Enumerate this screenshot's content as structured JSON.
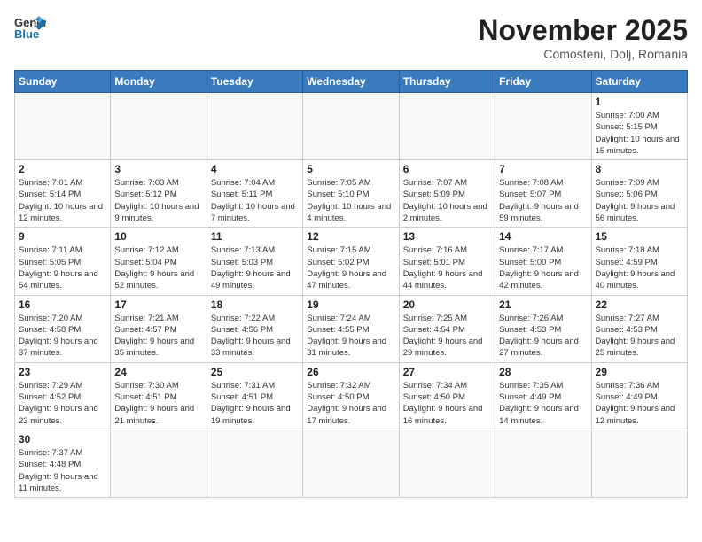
{
  "logo": {
    "text_general": "General",
    "text_blue": "Blue"
  },
  "title": "November 2025",
  "location": "Comosteni, Dolj, Romania",
  "days_of_week": [
    "Sunday",
    "Monday",
    "Tuesday",
    "Wednesday",
    "Thursday",
    "Friday",
    "Saturday"
  ],
  "weeks": [
    [
      {
        "day": "",
        "info": ""
      },
      {
        "day": "",
        "info": ""
      },
      {
        "day": "",
        "info": ""
      },
      {
        "day": "",
        "info": ""
      },
      {
        "day": "",
        "info": ""
      },
      {
        "day": "",
        "info": ""
      },
      {
        "day": "1",
        "info": "Sunrise: 7:00 AM\nSunset: 5:15 PM\nDaylight: 10 hours\nand 15 minutes."
      }
    ],
    [
      {
        "day": "2",
        "info": "Sunrise: 7:01 AM\nSunset: 5:14 PM\nDaylight: 10 hours\nand 12 minutes."
      },
      {
        "day": "3",
        "info": "Sunrise: 7:03 AM\nSunset: 5:12 PM\nDaylight: 10 hours\nand 9 minutes."
      },
      {
        "day": "4",
        "info": "Sunrise: 7:04 AM\nSunset: 5:11 PM\nDaylight: 10 hours\nand 7 minutes."
      },
      {
        "day": "5",
        "info": "Sunrise: 7:05 AM\nSunset: 5:10 PM\nDaylight: 10 hours\nand 4 minutes."
      },
      {
        "day": "6",
        "info": "Sunrise: 7:07 AM\nSunset: 5:09 PM\nDaylight: 10 hours\nand 2 minutes."
      },
      {
        "day": "7",
        "info": "Sunrise: 7:08 AM\nSunset: 5:07 PM\nDaylight: 9 hours\nand 59 minutes."
      },
      {
        "day": "8",
        "info": "Sunrise: 7:09 AM\nSunset: 5:06 PM\nDaylight: 9 hours\nand 56 minutes."
      }
    ],
    [
      {
        "day": "9",
        "info": "Sunrise: 7:11 AM\nSunset: 5:05 PM\nDaylight: 9 hours\nand 54 minutes."
      },
      {
        "day": "10",
        "info": "Sunrise: 7:12 AM\nSunset: 5:04 PM\nDaylight: 9 hours\nand 52 minutes."
      },
      {
        "day": "11",
        "info": "Sunrise: 7:13 AM\nSunset: 5:03 PM\nDaylight: 9 hours\nand 49 minutes."
      },
      {
        "day": "12",
        "info": "Sunrise: 7:15 AM\nSunset: 5:02 PM\nDaylight: 9 hours\nand 47 minutes."
      },
      {
        "day": "13",
        "info": "Sunrise: 7:16 AM\nSunset: 5:01 PM\nDaylight: 9 hours\nand 44 minutes."
      },
      {
        "day": "14",
        "info": "Sunrise: 7:17 AM\nSunset: 5:00 PM\nDaylight: 9 hours\nand 42 minutes."
      },
      {
        "day": "15",
        "info": "Sunrise: 7:18 AM\nSunset: 4:59 PM\nDaylight: 9 hours\nand 40 minutes."
      }
    ],
    [
      {
        "day": "16",
        "info": "Sunrise: 7:20 AM\nSunset: 4:58 PM\nDaylight: 9 hours\nand 37 minutes."
      },
      {
        "day": "17",
        "info": "Sunrise: 7:21 AM\nSunset: 4:57 PM\nDaylight: 9 hours\nand 35 minutes."
      },
      {
        "day": "18",
        "info": "Sunrise: 7:22 AM\nSunset: 4:56 PM\nDaylight: 9 hours\nand 33 minutes."
      },
      {
        "day": "19",
        "info": "Sunrise: 7:24 AM\nSunset: 4:55 PM\nDaylight: 9 hours\nand 31 minutes."
      },
      {
        "day": "20",
        "info": "Sunrise: 7:25 AM\nSunset: 4:54 PM\nDaylight: 9 hours\nand 29 minutes."
      },
      {
        "day": "21",
        "info": "Sunrise: 7:26 AM\nSunset: 4:53 PM\nDaylight: 9 hours\nand 27 minutes."
      },
      {
        "day": "22",
        "info": "Sunrise: 7:27 AM\nSunset: 4:53 PM\nDaylight: 9 hours\nand 25 minutes."
      }
    ],
    [
      {
        "day": "23",
        "info": "Sunrise: 7:29 AM\nSunset: 4:52 PM\nDaylight: 9 hours\nand 23 minutes."
      },
      {
        "day": "24",
        "info": "Sunrise: 7:30 AM\nSunset: 4:51 PM\nDaylight: 9 hours\nand 21 minutes."
      },
      {
        "day": "25",
        "info": "Sunrise: 7:31 AM\nSunset: 4:51 PM\nDaylight: 9 hours\nand 19 minutes."
      },
      {
        "day": "26",
        "info": "Sunrise: 7:32 AM\nSunset: 4:50 PM\nDaylight: 9 hours\nand 17 minutes."
      },
      {
        "day": "27",
        "info": "Sunrise: 7:34 AM\nSunset: 4:50 PM\nDaylight: 9 hours\nand 16 minutes."
      },
      {
        "day": "28",
        "info": "Sunrise: 7:35 AM\nSunset: 4:49 PM\nDaylight: 9 hours\nand 14 minutes."
      },
      {
        "day": "29",
        "info": "Sunrise: 7:36 AM\nSunset: 4:49 PM\nDaylight: 9 hours\nand 12 minutes."
      }
    ],
    [
      {
        "day": "30",
        "info": "Sunrise: 7:37 AM\nSunset: 4:48 PM\nDaylight: 9 hours\nand 11 minutes."
      },
      {
        "day": "",
        "info": ""
      },
      {
        "day": "",
        "info": ""
      },
      {
        "day": "",
        "info": ""
      },
      {
        "day": "",
        "info": ""
      },
      {
        "day": "",
        "info": ""
      },
      {
        "day": "",
        "info": ""
      }
    ]
  ]
}
